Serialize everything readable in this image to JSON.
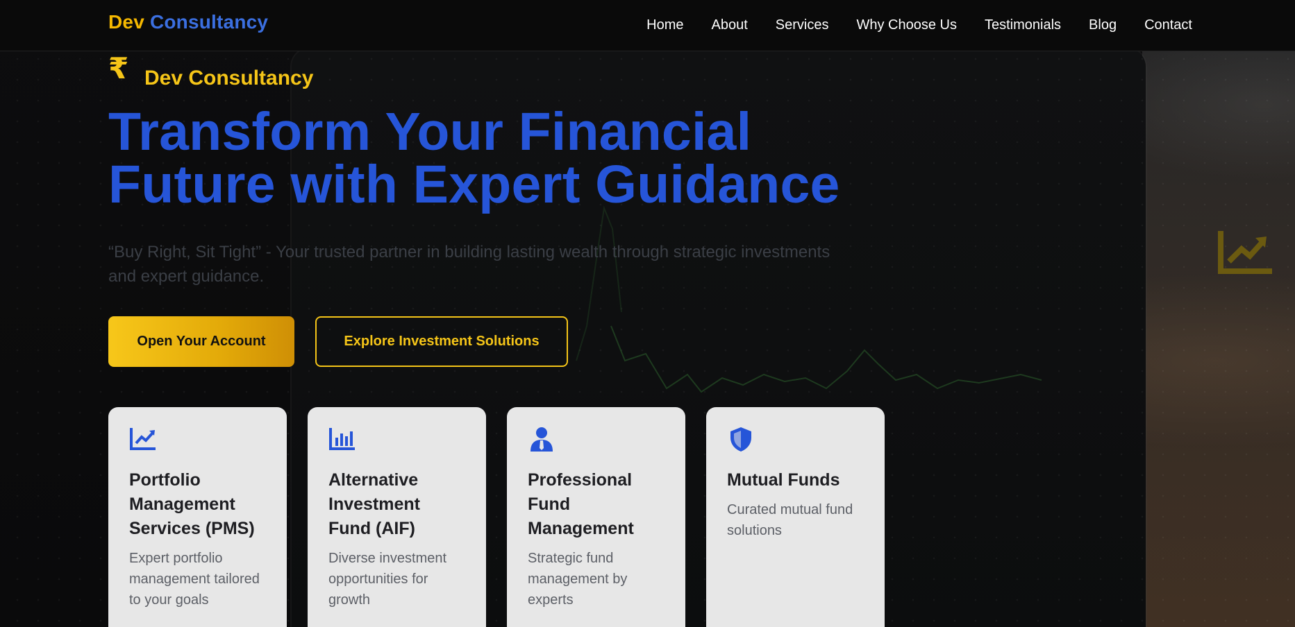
{
  "nav": {
    "logo_part1": "Dev",
    "logo_part2": "Consultancy",
    "links": [
      "Home",
      "About",
      "Services",
      "Why Choose Us",
      "Testimonials",
      "Blog",
      "Contact"
    ]
  },
  "hero": {
    "currency_symbol": "₹",
    "brand": "Dev Consultancy",
    "headline_line1": "Transform Your Financial",
    "headline_line2": "Future with Expert Guidance",
    "subtitle": "“Buy Right, Sit Tight” - Your trusted partner in building lasting wealth through strategic investments and expert guidance.",
    "primary_cta": "Open Your Account",
    "secondary_cta": "Explore Investment Solutions"
  },
  "cards": [
    {
      "icon": "trend-chart-icon",
      "title": "Portfolio Management Services (PMS)",
      "description": "Expert portfolio management tailored to your goals"
    },
    {
      "icon": "bar-chart-icon",
      "title": "Alternative Investment Fund (AIF)",
      "description": "Diverse investment opportunities for growth"
    },
    {
      "icon": "user-tie-icon",
      "title": "Professional Fund Management",
      "description": "Strategic fund management by experts"
    },
    {
      "icon": "shield-icon",
      "title": "Mutual Funds",
      "description": "Curated mutual fund solutions"
    }
  ],
  "colors": {
    "gold": "#f5c518",
    "blue": "#2655d8",
    "card_bg": "#e7e7e7",
    "nav_bg": "#0a0a0a"
  }
}
